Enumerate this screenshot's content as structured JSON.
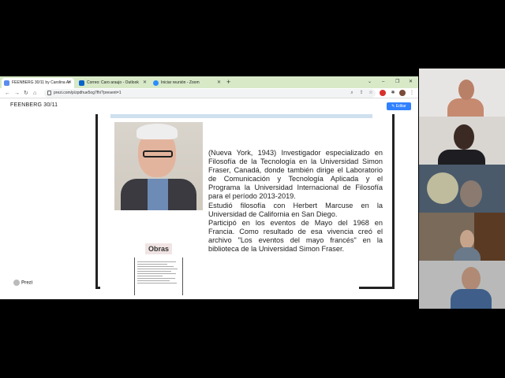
{
  "browser": {
    "tabs": [
      {
        "label": "FEENBERG 30/11 by Carolina Ar",
        "color": "#5b8def"
      },
      {
        "label": "Correo: Caro araujo - Outlook",
        "color": "#0a64c8"
      },
      {
        "label": "Iniciar reunión - Zoom",
        "color": "#2d8cff"
      }
    ],
    "new_tab": "+",
    "url": "prezi.com/p/zpdhue5og7fh/?present=1",
    "window_controls": [
      "–",
      "❐",
      "✕"
    ]
  },
  "presentation": {
    "title": "FEENBERG 30/11",
    "edit_label": "Editar",
    "logo_label": "Prezi"
  },
  "slide": {
    "obras_label": "Obras",
    "bio_paragraphs": [
      "(Nueva York, 1943) Investigador especializado en Filosofía de la Tecnología en la Universidad Simon Fraser, Canadá, donde también dirige el Laboratorio de Comunicación y Tecnología Aplicada y el Programa la Universidad Internacional de Filosofía para el período 2013-2019.",
      "Estudió filosofía con Herbert Marcuse en la Universidad de California en San Diego.",
      "Participó en los eventos de Mayo del 1968 en Francia. Como resultado de esa vivencia creó el archivo \"Los eventos del mayo francés\" en la biblioteca de la Universidad Simon Fraser."
    ]
  },
  "participants": [
    "participant-1",
    "participant-2",
    "participant-3",
    "participant-4",
    "participant-5"
  ]
}
